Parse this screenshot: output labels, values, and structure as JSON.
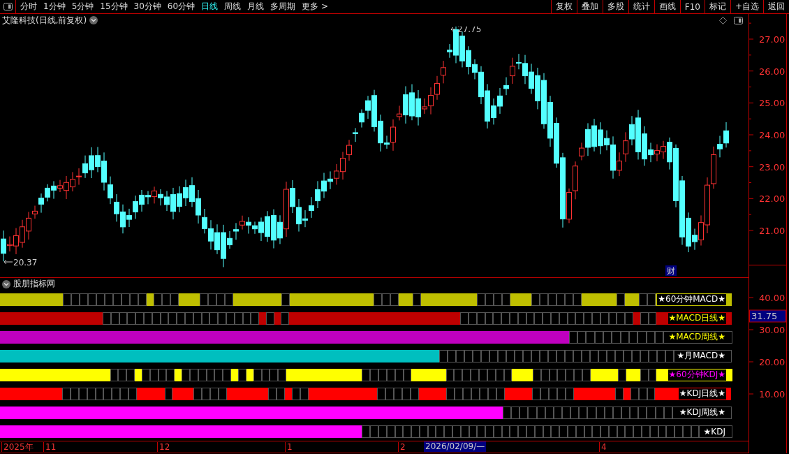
{
  "toolbar": {
    "periods": [
      {
        "label": "分时",
        "selected": false
      },
      {
        "label": "1分钟",
        "selected": false
      },
      {
        "label": "5分钟",
        "selected": false
      },
      {
        "label": "15分钟",
        "selected": false
      },
      {
        "label": "30分钟",
        "selected": false
      },
      {
        "label": "60分钟",
        "selected": false
      },
      {
        "label": "日线",
        "selected": true
      },
      {
        "label": "周线",
        "selected": false
      },
      {
        "label": "月线",
        "selected": false
      },
      {
        "label": "多周期",
        "selected": false
      },
      {
        "label": "更多 >",
        "selected": false
      }
    ],
    "buttons": [
      "复权",
      "叠加",
      "多股",
      "统计",
      "画线",
      "F10",
      "标记",
      "+自选",
      "返回"
    ]
  },
  "chart": {
    "title": "艾隆科技(日线,前复权)",
    "high_marker": "27.75",
    "low_marker": "20.37",
    "badge": "财",
    "y_labels": [
      "27.00",
      "26.00",
      "25.00",
      "24.00",
      "23.00",
      "22.00",
      "21.00"
    ]
  },
  "indicator_panel": {
    "title": "股朋指标网",
    "y_labels": [
      "40.00",
      "30.00",
      "20.00",
      "10.00"
    ],
    "current_value": "31.75",
    "rows": [
      {
        "label": {
          "text": "★60分钟MACD★",
          "color": "#ffffff"
        },
        "color": "#bfbf00",
        "cells": [
          true,
          true,
          true,
          true,
          true,
          true,
          true,
          true,
          true,
          false,
          false,
          false,
          false,
          false,
          false,
          false,
          false,
          false,
          false,
          true,
          false,
          false,
          false,
          true,
          true,
          true,
          false,
          false,
          false,
          false,
          true,
          true,
          true,
          true,
          true,
          true,
          true,
          false,
          true,
          true,
          true,
          true,
          true,
          true,
          true,
          true,
          true,
          true,
          true,
          true,
          false,
          false,
          false,
          true,
          true,
          false,
          true,
          true,
          true,
          true,
          true,
          true,
          true,
          true,
          false,
          false,
          false,
          false,
          true,
          true,
          true,
          false,
          false,
          false,
          false,
          false,
          false,
          true,
          true,
          true,
          true,
          true,
          false,
          true,
          true,
          false,
          false,
          true,
          true,
          true,
          true,
          true,
          true,
          true,
          true,
          true,
          true,
          true
        ]
      },
      {
        "label": {
          "text": "★MACD日线★",
          "color": "#ffff00"
        },
        "color": "#bf0000",
        "cells": [
          true,
          true,
          true,
          true,
          true,
          true,
          true,
          true,
          true,
          true,
          true,
          true,
          true,
          true,
          true,
          false,
          false,
          false,
          false,
          false,
          false,
          false,
          false,
          false,
          false,
          false,
          false,
          false,
          false,
          false,
          false,
          false,
          false,
          false,
          true,
          false,
          true,
          false,
          true,
          true,
          true,
          true,
          true,
          true,
          true,
          true,
          true,
          true,
          true,
          true,
          true,
          true,
          true,
          true,
          true,
          true,
          true,
          true,
          true,
          true,
          true,
          true,
          true,
          false,
          false,
          false,
          false,
          false,
          false,
          false,
          false,
          false,
          false,
          false,
          false,
          false,
          false,
          false,
          false,
          false,
          false,
          false,
          false,
          false,
          true,
          false,
          false,
          true,
          true,
          true,
          true,
          true,
          true,
          true,
          true,
          true,
          true,
          true
        ]
      },
      {
        "label": {
          "text": "★MACD周线★",
          "color": "#ffff00"
        },
        "color": "#bf00bf",
        "cells": [
          true,
          true,
          true,
          true,
          true,
          true,
          true,
          true,
          true,
          true,
          true,
          true,
          true,
          true,
          true,
          true,
          true,
          true,
          true,
          true,
          true,
          true,
          true,
          true,
          true,
          true,
          true,
          true,
          true,
          true,
          true,
          true,
          true,
          true,
          true,
          true,
          true,
          true,
          true,
          true,
          true,
          true,
          true,
          true,
          true,
          true,
          true,
          true,
          true,
          true,
          true,
          true,
          true,
          true,
          true,
          true,
          true,
          true,
          true,
          true,
          true,
          true,
          true,
          true,
          true,
          true,
          true,
          true,
          true,
          true,
          true,
          true,
          true,
          true,
          true,
          true,
          true,
          true,
          true,
          false,
          false,
          false,
          false,
          false,
          false,
          false,
          false,
          false,
          false,
          false,
          false,
          false,
          false,
          false,
          false,
          false,
          false,
          false
        ]
      },
      {
        "label": {
          "text": "★月MACD★",
          "color": "#ffffff"
        },
        "color": "#00bfbf",
        "cells": [
          true,
          true,
          true,
          true,
          true,
          true,
          true,
          true,
          true,
          true,
          true,
          true,
          true,
          true,
          true,
          true,
          true,
          true,
          true,
          true,
          true,
          true,
          true,
          true,
          true,
          true,
          true,
          true,
          true,
          true,
          true,
          true,
          true,
          true,
          true,
          true,
          true,
          true,
          true,
          true,
          true,
          true,
          true,
          true,
          true,
          true,
          true,
          true,
          true,
          true,
          true,
          true,
          true,
          true,
          true,
          true,
          true,
          true,
          true,
          true,
          true,
          true,
          true,
          false,
          false,
          false,
          false,
          false,
          false,
          false,
          false,
          false,
          false,
          false,
          false,
          false,
          false,
          false,
          false,
          false,
          false,
          false,
          false,
          false,
          false,
          false,
          false,
          false,
          false,
          false,
          false,
          false,
          false,
          false,
          false,
          false,
          false,
          false
        ]
      },
      {
        "label": {
          "text": "★60分钟KDJ★",
          "color": "#ff00ff"
        },
        "color": "#ffff00",
        "cells": [
          true,
          true,
          true,
          true,
          true,
          true,
          true,
          true,
          true,
          true,
          true,
          true,
          true,
          true,
          true,
          true,
          false,
          false,
          false,
          true,
          false,
          false,
          false,
          false,
          true,
          false,
          false,
          false,
          false,
          false,
          false,
          true,
          false,
          true,
          false,
          false,
          false,
          false,
          true,
          true,
          true,
          true,
          true,
          true,
          true,
          true,
          true,
          true,
          true,
          false,
          false,
          false,
          false,
          false,
          false,
          true,
          true,
          true,
          true,
          true,
          false,
          false,
          false,
          false,
          false,
          false,
          false,
          false,
          true,
          true,
          true,
          false,
          false,
          false,
          false,
          false,
          false,
          false,
          true,
          true,
          true,
          true,
          false,
          true,
          true,
          false,
          false,
          true,
          true,
          true,
          true,
          true,
          true,
          true,
          true,
          true,
          true,
          true
        ]
      },
      {
        "label": {
          "text": "★KDJ日线★",
          "color": "#ffffff"
        },
        "color": "#ff0000",
        "cells": [
          true,
          true,
          true,
          true,
          true,
          true,
          true,
          true,
          true,
          false,
          false,
          false,
          false,
          false,
          false,
          false,
          false,
          false,
          true,
          true,
          true,
          true,
          false,
          true,
          true,
          true,
          false,
          false,
          false,
          false,
          true,
          true,
          true,
          true,
          true,
          true,
          false,
          false,
          true,
          false,
          false,
          true,
          true,
          true,
          true,
          true,
          true,
          true,
          true,
          true,
          true,
          false,
          false,
          false,
          false,
          false,
          true,
          true,
          true,
          true,
          false,
          false,
          false,
          false,
          false,
          false,
          false,
          true,
          true,
          true,
          true,
          false,
          false,
          false,
          false,
          false,
          true,
          true,
          true,
          true,
          true,
          true,
          false,
          true,
          false,
          false,
          false,
          true,
          true,
          true,
          true,
          true,
          true,
          true,
          true,
          true,
          true,
          true
        ]
      },
      {
        "label": {
          "text": "★KDJ周线★",
          "color": "#ffffff"
        },
        "color": "#ff00ff",
        "cells": [
          true,
          true,
          true,
          true,
          true,
          true,
          true,
          true,
          true,
          true,
          true,
          true,
          true,
          true,
          true,
          true,
          true,
          true,
          true,
          true,
          true,
          true,
          true,
          true,
          true,
          true,
          true,
          true,
          true,
          true,
          true,
          true,
          true,
          true,
          true,
          true,
          true,
          true,
          true,
          true,
          true,
          true,
          true,
          true,
          true,
          true,
          true,
          true,
          true,
          true,
          true,
          true,
          true,
          true,
          true,
          true,
          true,
          true,
          true,
          true,
          true,
          true,
          true,
          true,
          true,
          true,
          true,
          true,
          true,
          true,
          true,
          false,
          false,
          false,
          false,
          false,
          false,
          false,
          false,
          false,
          false,
          false,
          false,
          false,
          false,
          false,
          false,
          false,
          false,
          false,
          false,
          false,
          false,
          false,
          false,
          false,
          false,
          false
        ]
      },
      {
        "label": {
          "text": "★KDJ",
          "color": "#ffffff"
        },
        "color": "#ff00ff",
        "cells": [
          true,
          true,
          true,
          true,
          true,
          true,
          true,
          true,
          true,
          true,
          true,
          true,
          true,
          true,
          true,
          true,
          true,
          true,
          true,
          true,
          true,
          true,
          true,
          true,
          true,
          true,
          true,
          true,
          true,
          true,
          true,
          true,
          true,
          true,
          true,
          true,
          true,
          true,
          true,
          true,
          true,
          true,
          true,
          true,
          true,
          true,
          true,
          true,
          true,
          true,
          true,
          true,
          true,
          false,
          false,
          false,
          false,
          false,
          false,
          false,
          false,
          false,
          false,
          false,
          false,
          false,
          false,
          false,
          false,
          false,
          false,
          false,
          false,
          false,
          false,
          false,
          false,
          false,
          false,
          false,
          false,
          false,
          false,
          false,
          false,
          false,
          false,
          false,
          false,
          false,
          false,
          false,
          false,
          false,
          false,
          false,
          false,
          false
        ]
      }
    ]
  },
  "date_axis": {
    "labels": [
      "2025年",
      "11",
      "12",
      "1",
      "2",
      "4"
    ],
    "cursor_date": "2026/02/09/—"
  }
}
